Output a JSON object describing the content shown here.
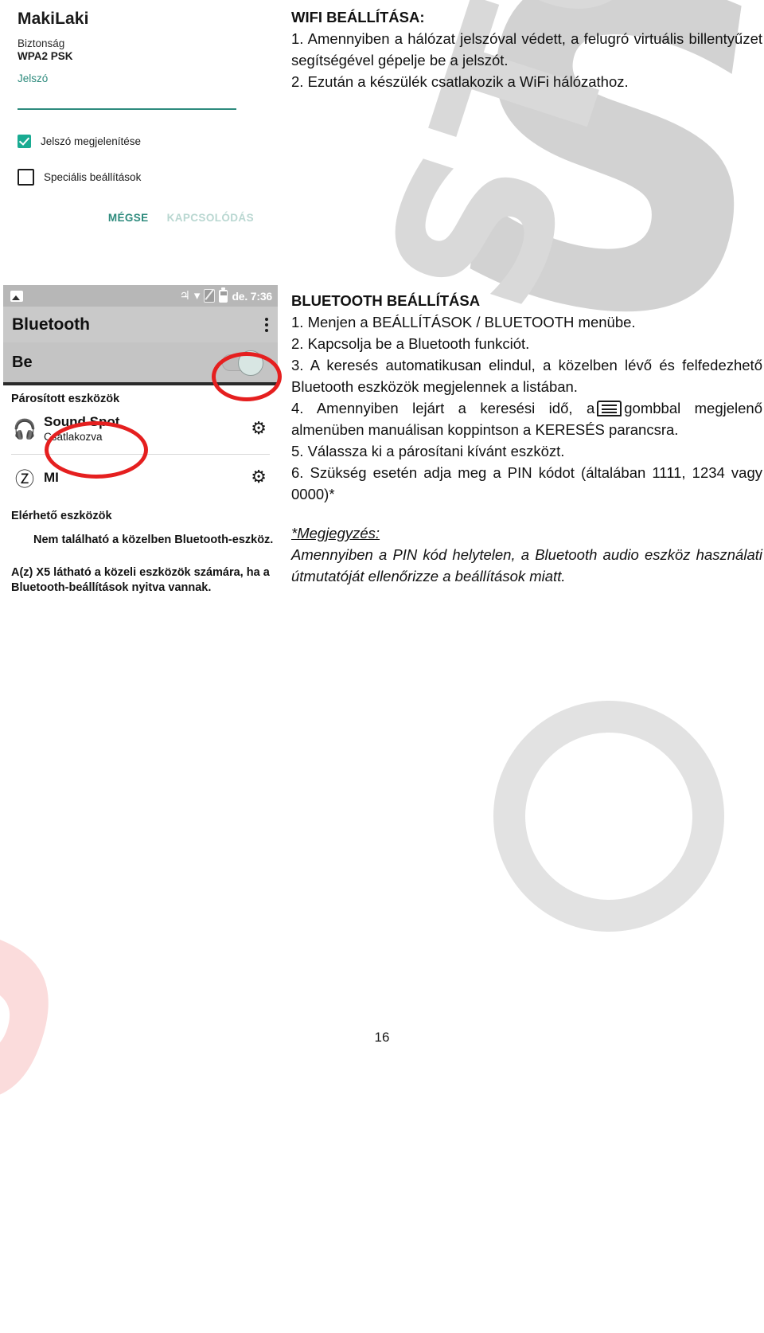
{
  "wifi_dialog": {
    "ssid": "MakiLaki",
    "security_label": "Biztonság",
    "security_value": "WPA2 PSK",
    "password_label": "Jelszó",
    "password_value": "",
    "checkbox_show_password": "Jelszó megjelenítése",
    "checkbox_advanced": "Speciális beállítások",
    "cancel_button": "MÉGSE",
    "connect_button": "KAPCSOLÓDÁS",
    "accent_color": "#2e8b7d",
    "checkbox_on_color": "#19ab92",
    "connect_disabled_color": "#b9d7d1"
  },
  "wifi_instructions": {
    "heading": "WIFI BEÁLLÍTÁSA:",
    "step1": "1. Amennyiben a hálózat jelszóval védett, a felugró virtuális billentyűzet segítségével gépelje be a jelszót.",
    "step2": "2. Ezután a készülék csatlakozik a WiFi hálózathoz."
  },
  "bluetooth_screenshot": {
    "status_bar": {
      "image_icon": "image-icon",
      "bluetooth_icon": "bluetooth-icon",
      "wifi_icon": "wifi-icon",
      "sim_icon": "sim-off-icon",
      "battery_icon": "battery-icon",
      "time": "de. 7:36"
    },
    "title": "Bluetooth",
    "overflow_icon": "kebab-menu-icon",
    "toggle_label": "Be",
    "toggle_state": "on",
    "paired_section": "Párosított eszközök",
    "devices": [
      {
        "icon": "headphones-icon",
        "name": "Sound Spot",
        "status": "Csatlakozva",
        "settings_icon": "gear-icon"
      },
      {
        "icon": "bluetooth-icon",
        "name": "MI",
        "status": "",
        "settings_icon": "gear-icon"
      }
    ],
    "available_section": "Elérhető eszközök",
    "none_found": "Nem található a közelben Bluetooth-eszköz.",
    "footer_note": "A(z) X5 látható a közeli eszközök számára, ha a Bluetooth-beállítások nyitva vannak.",
    "annotation_color": "#e51f1f"
  },
  "bluetooth_instructions": {
    "heading": "BLUETOOTH BEÁLLÍTÁSA",
    "step1": "1. Menjen a BEÁLLÍTÁSOK / BLUETOOTH menübe.",
    "step2": "2. Kapcsolja be a Bluetooth funkciót.",
    "step3": "3. A keresés automatikusan elindul, a közelben lévő és felfedezhető Bluetooth eszközök megjelennek a listában.",
    "step4_part1": "4. Amennyiben lejárt a keresési idő, a",
    "step4_icon": "menu-button-icon",
    "step4_part2": "gombbal megjelenő almenüben manuálisan koppintson a KERESÉS parancsra.",
    "step5": "5. Válassza ki a párosítani kívánt eszközt.",
    "step6": "6. Szükség esetén adja meg a PIN kódot (általában 1111, 1234 vagy 0000)*",
    "note_title": "*Megjegyzés:",
    "note_body": "Amennyiben a PIN kód helytelen, a Bluetooth audio eszköz használati útmutatóját ellenőrizze a beállítások miatt."
  },
  "watermarks": {
    "gray_letter": "S",
    "gray_word": "STOCK",
    "pink_word": "EU"
  },
  "page_number": "16"
}
